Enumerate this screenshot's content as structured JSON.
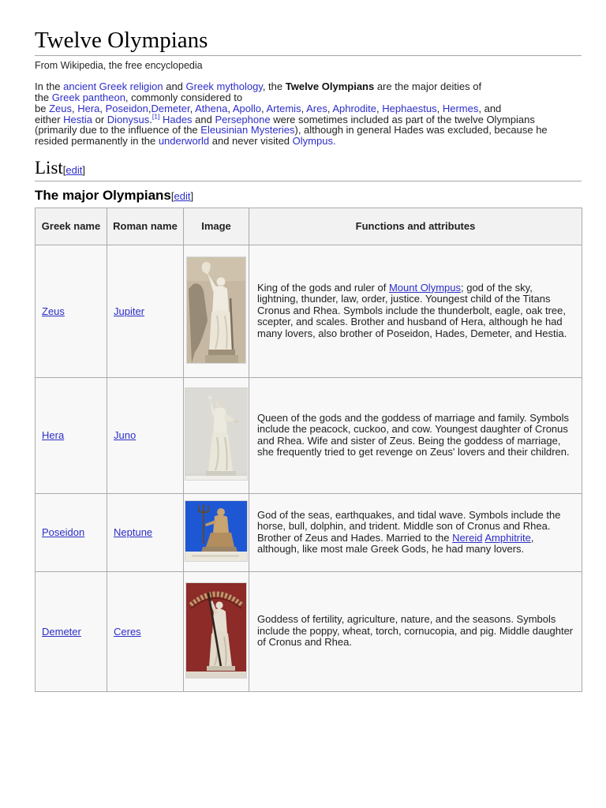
{
  "page": {
    "title": "Twelve Olympians",
    "subtitle": "From Wikipedia, the free encyclopedia"
  },
  "sections": {
    "list": {
      "title": "List",
      "edit": "edit",
      "bracket_open": "[",
      "bracket_close": "]"
    },
    "major_olympians": {
      "title": "The major Olympians",
      "edit": "edit",
      "bracket_open": "[",
      "bracket_close": "]"
    }
  },
  "intro": {
    "segments": [
      {
        "t": "In the "
      },
      {
        "t": "ancient Greek religion",
        "link": true
      },
      {
        "t": " and "
      },
      {
        "t": "Greek mythology",
        "link": true
      },
      {
        "t": ", the "
      },
      {
        "t": "Twelve Olympians",
        "bold": true
      },
      {
        "t": " are the major deities of"
      },
      {
        "br": true
      },
      {
        "t": "the "
      },
      {
        "t": "Greek pantheon",
        "link": true
      },
      {
        "t": ", commonly considered to"
      },
      {
        "br": true
      },
      {
        "t": "be "
      },
      {
        "t": "Zeus",
        "link": true
      },
      {
        "t": ", "
      },
      {
        "t": "Hera",
        "link": true
      },
      {
        "t": ", "
      },
      {
        "t": "Poseidon",
        "link": true
      },
      {
        "t": ","
      },
      {
        "t": "Demeter",
        "link": true
      },
      {
        "t": ", "
      },
      {
        "t": "Athena",
        "link": true
      },
      {
        "t": ", "
      },
      {
        "t": "Apollo",
        "link": true
      },
      {
        "t": ", "
      },
      {
        "t": "Artemis",
        "link": true
      },
      {
        "t": ", "
      },
      {
        "t": "Ares",
        "link": true
      },
      {
        "t": ", "
      },
      {
        "t": "Aphrodite",
        "link": true
      },
      {
        "t": ", "
      },
      {
        "t": "Hephaestus",
        "link": true
      },
      {
        "t": ", "
      },
      {
        "t": "Hermes",
        "link": true
      },
      {
        "t": ", and"
      },
      {
        "br": true
      },
      {
        "t": "either "
      },
      {
        "t": "Hestia",
        "link": true
      },
      {
        "t": " or "
      },
      {
        "t": "Dionysus",
        "link": true
      },
      {
        "t": "."
      },
      {
        "t": "[1]",
        "sup": true
      },
      {
        "t": " "
      },
      {
        "t": "Hades",
        "link": true
      },
      {
        "t": " and "
      },
      {
        "t": "Persephone",
        "link": true
      },
      {
        "t": " were sometimes included as part of the twelve Olympians"
      },
      {
        "br": true
      },
      {
        "t": "(primarily due to the influence of the "
      },
      {
        "t": "Eleusinian Mysteries",
        "link": true
      },
      {
        "t": "), although in general Hades was excluded, because he"
      },
      {
        "br": true
      },
      {
        "t": "resided permanently in the "
      },
      {
        "t": "underworld",
        "link": true
      },
      {
        "t": " and never visited "
      },
      {
        "t": "Olympus.",
        "link": true
      }
    ]
  },
  "table": {
    "headers": [
      "Greek name",
      "Roman name",
      "Image",
      "Functions and attributes"
    ],
    "rows": [
      {
        "greek": "Zeus",
        "roman": "Jupiter",
        "image": "zeus-statue-photo",
        "description": [
          {
            "t": "King of the gods and ruler of "
          },
          {
            "t": "Mount Olympus",
            "link": true
          },
          {
            "t": "; god of the sky, lightning, thunder, law, order, justice. Youngest child of the Titans Cronus and Rhea. Symbols include the thunderbolt, eagle, oak tree, scepter, and scales. Brother and husband of Hera, although he had many lovers, also brother of Poseidon, Hades, Demeter, and Hestia."
          }
        ]
      },
      {
        "greek": "Hera",
        "roman": "Juno",
        "image": "hera-statue-photo",
        "description": [
          {
            "t": "Queen of the gods and the goddess of marriage and family. Symbols include the peacock, cuckoo, and cow. Youngest daughter of Cronus and Rhea. Wife and sister of Zeus. Being the goddess of marriage, she frequently tried to get revenge on Zeus' lovers and their children."
          }
        ]
      },
      {
        "greek": "Poseidon",
        "roman": "Neptune",
        "image": "poseidon-statue-photo",
        "description": [
          {
            "t": "God of the seas, earthquakes, and tidal wave. Symbols include the horse, bull, dolphin, and trident. Middle son of Cronus and Rhea. Brother of Zeus and Hades. Married to the "
          },
          {
            "t": "Nereid",
            "link": true
          },
          {
            "t": " "
          },
          {
            "t": "Amphitrite",
            "link": true
          },
          {
            "t": ", although, like most male Greek Gods, he had many lovers."
          }
        ]
      },
      {
        "greek": "Demeter",
        "roman": "Ceres",
        "image": "demeter-statue-photo",
        "description": [
          {
            "t": "Goddess of fertility, agriculture, nature, and the seasons. Symbols include the poppy, wheat, torch, cornucopia, and pig. Middle daughter of Cronus and Rhea."
          }
        ]
      }
    ]
  },
  "colors": {
    "link": "#2d2dc8",
    "table_border": "#aaaaaa",
    "table_header_bg": "#f2f2f2",
    "table_cell_bg": "#f8f8f8",
    "heading_rule": "#a6a6a6"
  }
}
